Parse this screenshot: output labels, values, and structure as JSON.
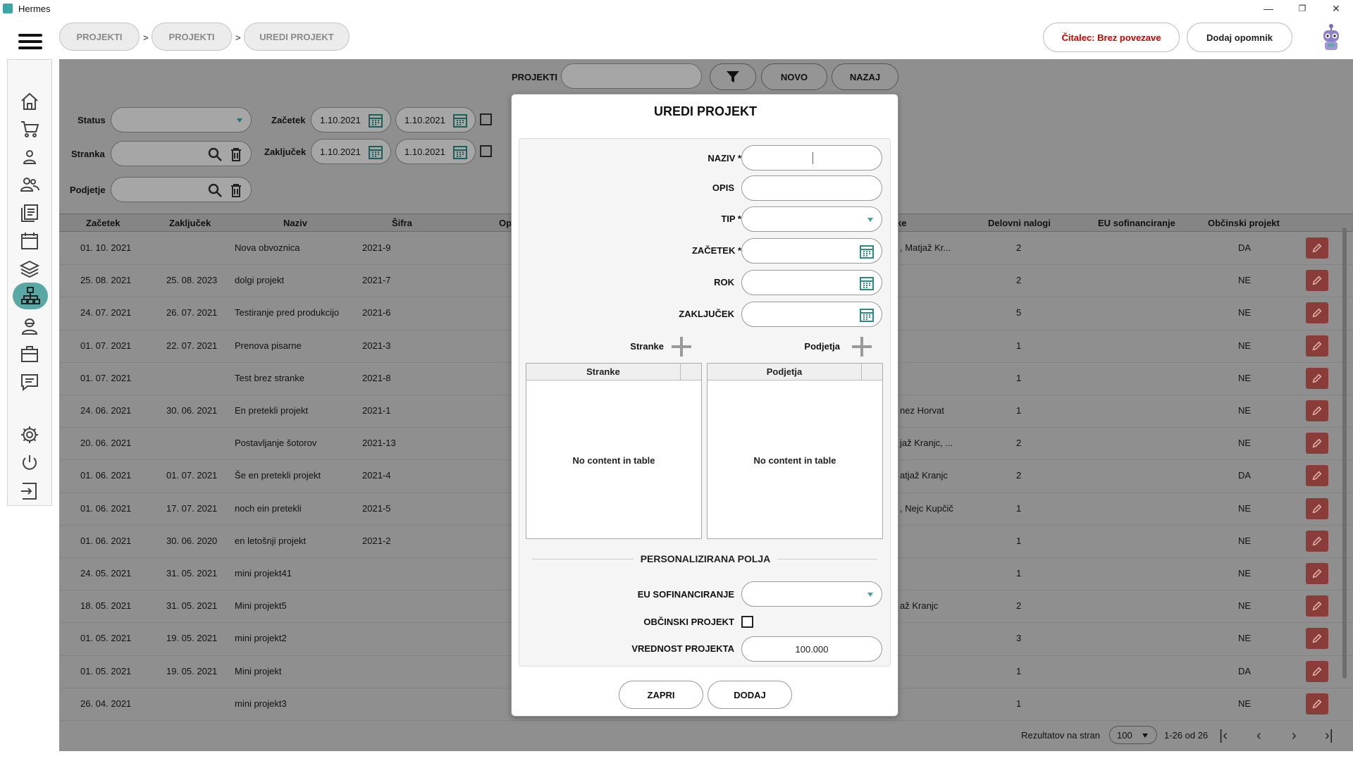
{
  "window": {
    "title": "Hermes",
    "minimize": "—",
    "maximize": "❐",
    "close": "✕"
  },
  "breadcrumb": [
    "PROJEKTI",
    "PROJEKTI",
    "UREDI PROJEKT"
  ],
  "breadcrumb_sep": ">",
  "topbar": {
    "reader_status": "Čitalec: Brez povezave",
    "add_reminder": "Dodaj opomnik",
    "reader_status_color": "#cc0000"
  },
  "sidebar": {
    "icons": [
      "home-icon",
      "cart-icon",
      "user-icon",
      "users-icon",
      "documents-icon",
      "calendar-icon",
      "layers-icon",
      "hierarchy-icon",
      "worker-icon",
      "briefcase-icon",
      "chat-icon",
      "gear-icon",
      "power-icon",
      "logout-icon"
    ],
    "active": "hierarchy-icon",
    "accent": "#5aa8a4"
  },
  "toolbar": {
    "label": "PROJEKTI",
    "search_value": "",
    "new_button": "NOVO",
    "back_button": "NAZAJ"
  },
  "filters": {
    "status_label": "Status",
    "client_label": "Stranka",
    "company_label": "Podjetje",
    "start_label": "Začetek",
    "end_label": "Zaključek",
    "start_from": "1.10.2021",
    "start_to": "1.10.2021",
    "end_from": "1.10.2021",
    "end_to": "1.10.2021"
  },
  "table": {
    "headers": [
      "Začetek",
      "Zaključek",
      "Naziv",
      "Šifra",
      "Op",
      "ke",
      "Delovni nalogi",
      "EU sofinanciranje",
      "Občinski projekt"
    ],
    "rows": [
      [
        "01. 10. 2021",
        "",
        "Nova obvoznica",
        "2021-9",
        ", Matjaž Kr...",
        "2",
        "DA"
      ],
      [
        "25. 08. 2021",
        "25. 08. 2023",
        "dolgi projekt",
        "2021-7",
        "",
        "2",
        "NE"
      ],
      [
        "24. 07. 2021",
        "26. 07. 2021",
        "Testiranje pred produkcijo",
        "2021-6",
        "",
        "5",
        "NE"
      ],
      [
        "01. 07. 2021",
        "22. 07. 2021",
        "Prenova pisarne",
        "2021-3",
        "",
        "1",
        "NE"
      ],
      [
        "01. 07. 2021",
        "",
        "Test brez stranke",
        "2021-8",
        "",
        "1",
        "NE"
      ],
      [
        "24. 06. 2021",
        "30. 06. 2021",
        "En pretekli projekt",
        "2021-1",
        "nez Horvat",
        "1",
        "NE"
      ],
      [
        "20. 06. 2021",
        "",
        "Postavljanje šotorov",
        "2021-13",
        "jaž Kranjc, ...",
        "2",
        "NE"
      ],
      [
        "01. 06. 2021",
        "01. 07. 2021",
        "Še en pretekli projekt",
        "2021-4",
        "atjaž Kranjc",
        "2",
        "DA"
      ],
      [
        "01. 06. 2021",
        "17. 07. 2021",
        "noch ein pretekli",
        "2021-5",
        ", Nejc Kupčič",
        "1",
        "NE"
      ],
      [
        "01. 06. 2021",
        "30. 06. 2020",
        "en letošnji projekt",
        "2021-2",
        "",
        "1",
        "NE"
      ],
      [
        "24. 05. 2021",
        "31. 05. 2021",
        "mini projekt41",
        "",
        "",
        "1",
        "NE"
      ],
      [
        "18. 05. 2021",
        "31. 05. 2021",
        "Mini projekt5",
        "",
        "až Kranjc",
        "2",
        "NE"
      ],
      [
        "01. 05. 2021",
        "19. 05. 2021",
        "mini projekt2",
        "",
        "",
        "3",
        "NE"
      ],
      [
        "01. 05. 2021",
        "19. 05. 2021",
        "Mini projekt",
        "",
        "",
        "1",
        "DA"
      ],
      [
        "26. 04. 2021",
        "",
        "mini projekt3",
        "",
        "",
        "1",
        "NE"
      ]
    ]
  },
  "footer": {
    "per_page_label": "Rezultatov na stran",
    "per_page_value": "100",
    "range": "1-26 od 26"
  },
  "modal": {
    "title": "UREDI PROJEKT",
    "naziv_label": "NAZIV *",
    "opis_label": "OPIS",
    "tip_label": "TIP *",
    "zacetek_label": "ZAČETEK *",
    "rok_label": "ROK",
    "zakljucek_label": "ZAKLJUČEK",
    "stranke_label": "Stranke",
    "podjetja_label": "Podjetja",
    "stranke_table_header": "Stranke",
    "podjetja_table_header": "Podjetja",
    "empty_text": "No content in table",
    "section_title": "PERSONALIZIRANA POLJA",
    "eu_label": "EU SOFINANCIRANJE",
    "obcinski_label": "OBČINSKI PROJEKT",
    "vrednost_label": "VREDNOST PROJEKTA",
    "vrednost_value": "100.000",
    "close_button": "ZAPRI",
    "add_button": "DODAJ"
  }
}
